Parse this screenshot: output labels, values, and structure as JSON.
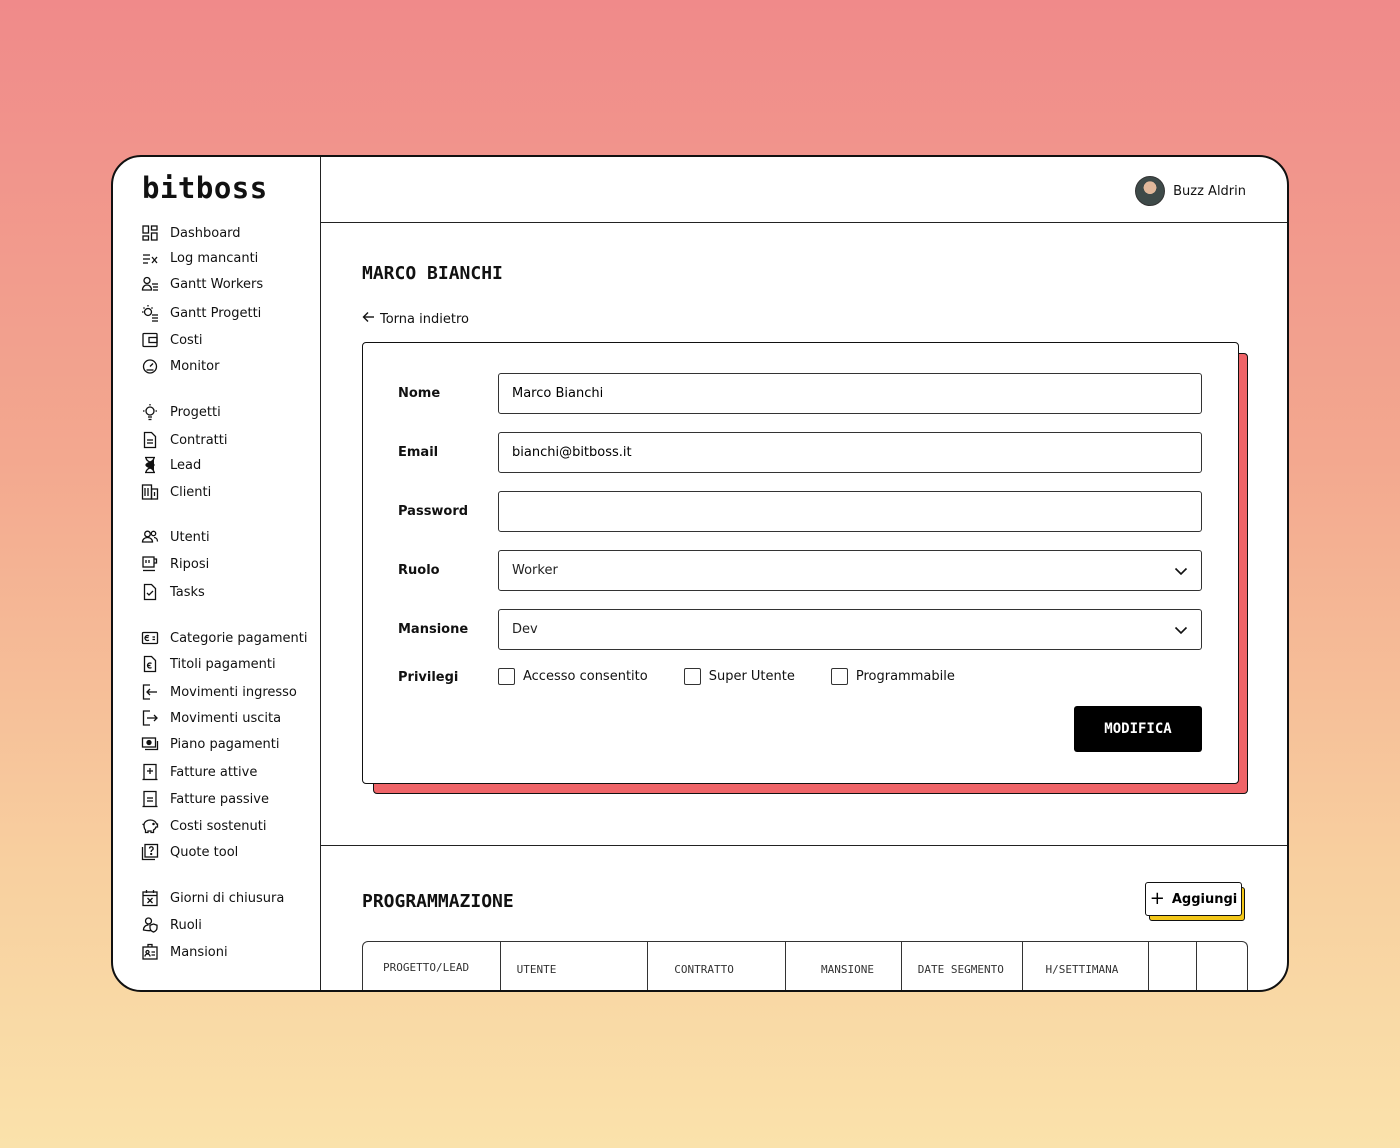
{
  "app": {
    "logo": "bitboss"
  },
  "user": {
    "name": "Buzz Aldrin"
  },
  "sidebar": {
    "items": [
      {
        "label": "Dashboard"
      },
      {
        "label": "Log mancanti"
      },
      {
        "label": "Gantt Workers"
      },
      {
        "label": "Gantt Progetti"
      },
      {
        "label": "Costi"
      },
      {
        "label": "Monitor"
      },
      {
        "label": "Progetti"
      },
      {
        "label": "Contratti"
      },
      {
        "label": "Lead"
      },
      {
        "label": "Clienti"
      },
      {
        "label": "Utenti"
      },
      {
        "label": "Riposi"
      },
      {
        "label": "Tasks"
      },
      {
        "label": "Categorie pagamenti"
      },
      {
        "label": "Titoli pagamenti"
      },
      {
        "label": "Movimenti ingresso"
      },
      {
        "label": "Movimenti uscita"
      },
      {
        "label": "Piano pagamenti"
      },
      {
        "label": "Fatture attive"
      },
      {
        "label": "Fatture passive"
      },
      {
        "label": "Costi sostenuti"
      },
      {
        "label": "Quote tool"
      },
      {
        "label": "Giorni di chiusura"
      },
      {
        "label": "Ruoli"
      },
      {
        "label": "Mansioni"
      }
    ]
  },
  "page": {
    "title": "MARCO BIANCHI",
    "back_label": "Torna indietro"
  },
  "form": {
    "nome_label": "Nome",
    "nome_value": "Marco Bianchi",
    "email_label": "Email",
    "email_value": "bianchi@bitboss.it",
    "password_label": "Password",
    "password_value": "",
    "ruolo_label": "Ruolo",
    "ruolo_value": "Worker",
    "mansione_label": "Mansione",
    "mansione_value": "Dev",
    "privilegi_label": "Privilegi",
    "privilegi": [
      {
        "label": "Accesso consentito",
        "checked": false
      },
      {
        "label": "Super Utente",
        "checked": false
      },
      {
        "label": "Programmabile",
        "checked": false
      }
    ],
    "submit_label": "MODIFICA"
  },
  "programmazione": {
    "title": "PROGRAMMAZIONE",
    "add_label": "Aggiungi",
    "columns": [
      "PROGETTO/LEAD",
      "UTENTE",
      "CONTRATTO",
      "MANSIONE",
      "DATE SEGMENTO",
      "H/SETTIMANA",
      "",
      ""
    ]
  },
  "colors": {
    "card_shadow": "#ef6468",
    "add_shadow": "#f2c619",
    "primary_button": "#000000"
  }
}
